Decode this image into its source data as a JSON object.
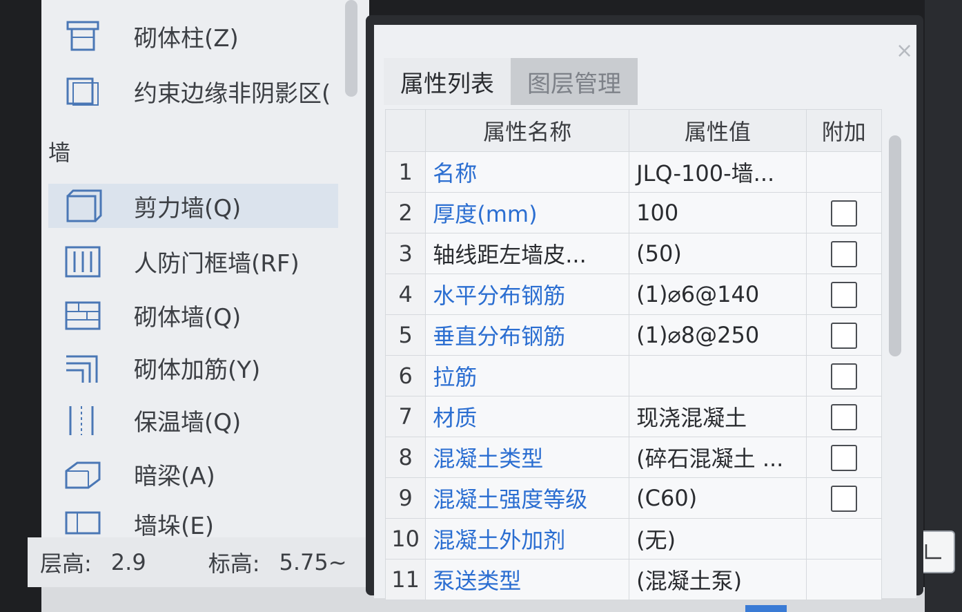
{
  "tree": {
    "items_top": [
      {
        "label": "砌体柱(Z)",
        "icon": "masonry-column-icon"
      },
      {
        "label": "约束边缘非阴影区(",
        "icon": "constraint-edge-icon"
      }
    ],
    "category": "墙",
    "items_wall": [
      {
        "label": "剪力墙(Q)",
        "icon": "shear-wall-icon",
        "selected": true
      },
      {
        "label": "人防门框墙(RF)",
        "icon": "civil-defense-door-wall-icon"
      },
      {
        "label": "砌体墙(Q)",
        "icon": "masonry-wall-icon"
      },
      {
        "label": "砌体加筋(Y)",
        "icon": "masonry-reinforcement-icon"
      },
      {
        "label": "保温墙(Q)",
        "icon": "insulation-wall-icon"
      },
      {
        "label": "暗梁(A)",
        "icon": "hidden-beam-icon"
      },
      {
        "label": "墙垛(E)",
        "icon": "wall-pier-icon"
      }
    ]
  },
  "status": {
    "floor_height_label": "层高:",
    "floor_height_value": "2.9",
    "elevation_label": "标高:",
    "elevation_value": "5.75~"
  },
  "dialog": {
    "close": "×",
    "tabs": [
      {
        "label": "属性列表",
        "active": true
      },
      {
        "label": "图层管理",
        "active": false
      }
    ],
    "columns": {
      "name": "属性名称",
      "value": "属性值",
      "extra": "附加"
    },
    "rows": [
      {
        "num": "1",
        "name": "名称",
        "value": "JLQ-100-墙...",
        "link": true,
        "checkbox": false
      },
      {
        "num": "2",
        "name": "厚度(mm)",
        "value": "100",
        "link": true,
        "checkbox": true
      },
      {
        "num": "3",
        "name": "轴线距左墙皮...",
        "value": "(50)",
        "link": false,
        "checkbox": true
      },
      {
        "num": "4",
        "name": "水平分布钢筋",
        "value": "(1)⌀6@140",
        "link": true,
        "checkbox": true
      },
      {
        "num": "5",
        "name": "垂直分布钢筋",
        "value": "(1)⌀8@250",
        "link": true,
        "checkbox": true
      },
      {
        "num": "6",
        "name": "拉筋",
        "value": "",
        "link": true,
        "checkbox": true
      },
      {
        "num": "7",
        "name": "材质",
        "value": "现浇混凝土",
        "link": true,
        "checkbox": true
      },
      {
        "num": "8",
        "name": "混凝土类型",
        "value": "(碎石混凝土 ...",
        "link": true,
        "checkbox": true
      },
      {
        "num": "9",
        "name": "混凝土强度等级",
        "value": "(C60)",
        "link": true,
        "checkbox": true
      },
      {
        "num": "10",
        "name": "混凝土外加剂",
        "value": "(无)",
        "link": true,
        "checkbox": false
      },
      {
        "num": "11",
        "name": "泵送类型",
        "value": "(混凝土泵)",
        "link": true,
        "checkbox": false
      }
    ]
  },
  "colors": {
    "link": "#2b6ed1",
    "selection": "#dbe3ed"
  }
}
